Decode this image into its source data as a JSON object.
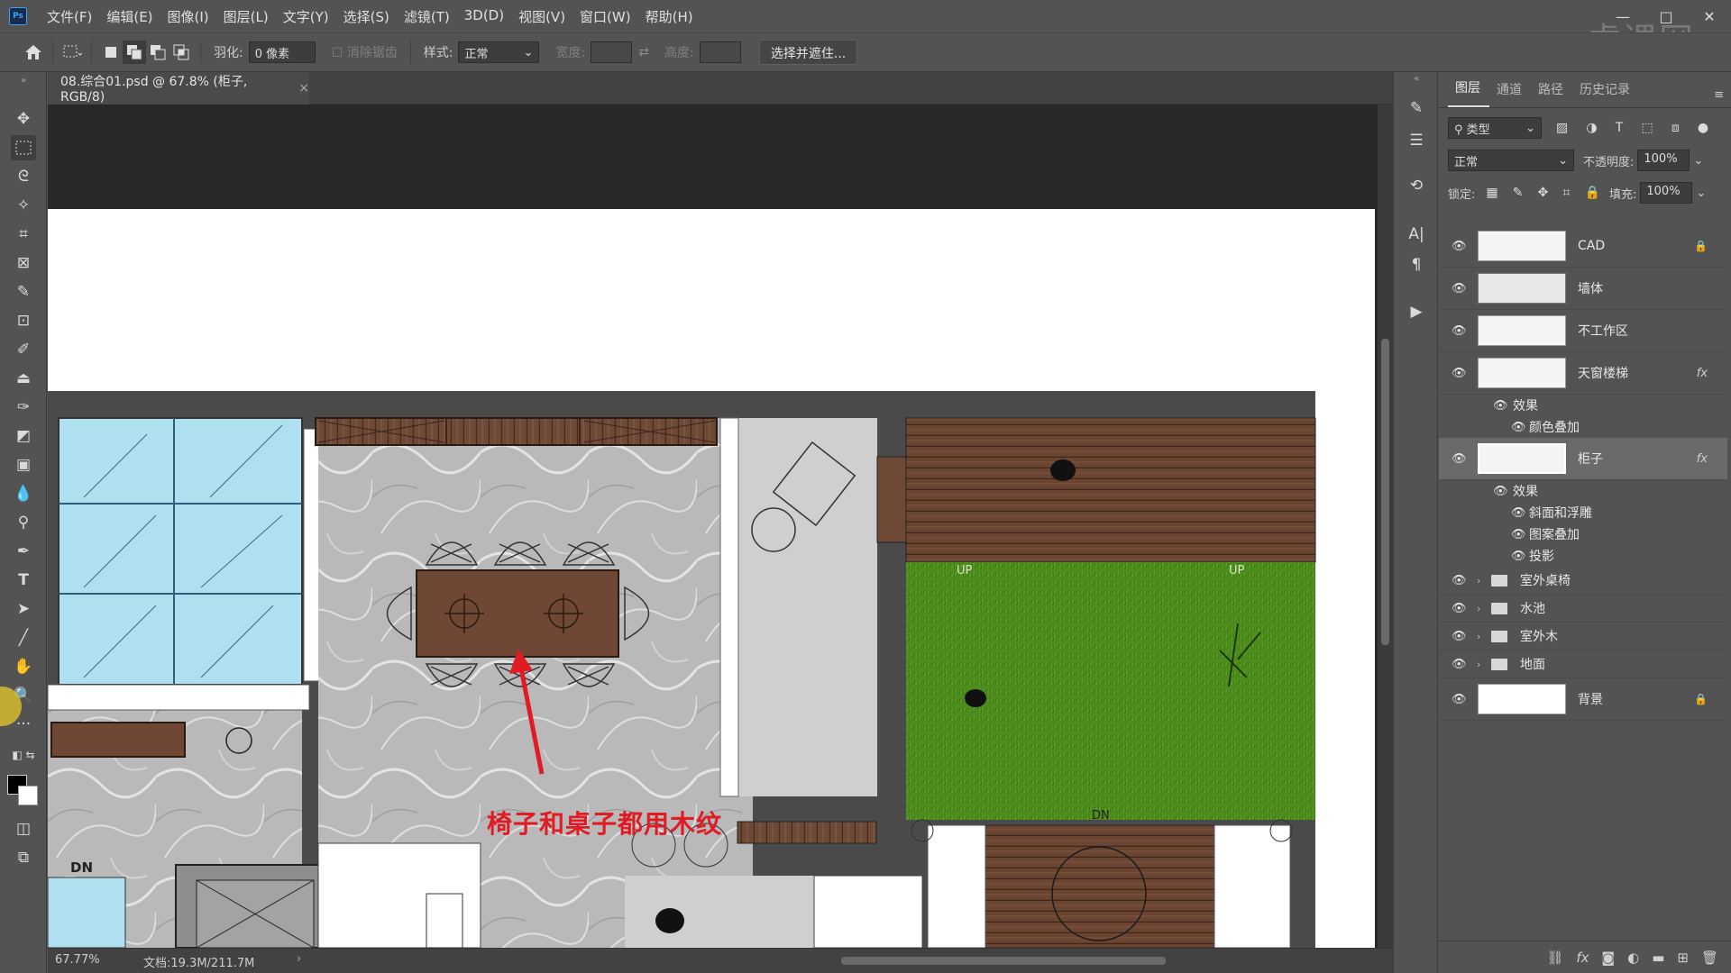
{
  "app": {
    "logo": "Ps",
    "watermark": "虎课网"
  },
  "menu": [
    "文件(F)",
    "编辑(E)",
    "图像(I)",
    "图层(L)",
    "文字(Y)",
    "选择(S)",
    "滤镜(T)",
    "3D(D)",
    "视图(V)",
    "窗口(W)",
    "帮助(H)"
  ],
  "window_controls": {
    "minimize": "—",
    "maximize": "□",
    "close": "✕"
  },
  "options": {
    "feather_label": "羽化:",
    "feather_value": "0 像素",
    "antialias_label": "消除锯齿",
    "style_label": "样式:",
    "style_value": "正常",
    "width_label": "宽度:",
    "height_label": "高度:",
    "select_mask_button": "选择并遮住..."
  },
  "document": {
    "tab_title": "08.综合01.psd @ 67.8% (柜子, RGB/8)",
    "close_glyph": "×",
    "zoom": "67.77%",
    "doc_size": "文档:19.3M/211.7M",
    "annotation": "椅子和桌子都用木纹"
  },
  "plan_labels": {
    "dn1": "DN",
    "dn2": "DN",
    "up1": "UP",
    "up2": "UP"
  },
  "panel": {
    "tabs": [
      "图层",
      "通道",
      "路径",
      "历史记录"
    ],
    "filter_label": "类型",
    "blend_mode": "正常",
    "opacity_label": "不透明度:",
    "opacity_value": "100%",
    "lock_label": "锁定:",
    "fill_label": "填充:",
    "fill_value": "100%"
  },
  "layers": [
    {
      "name": "CAD",
      "kind": "layer",
      "locked": true
    },
    {
      "name": "墙体",
      "kind": "layer"
    },
    {
      "name": "不工作区",
      "kind": "layer"
    },
    {
      "name": "天窗楼梯",
      "kind": "layer",
      "fx": "fx"
    },
    {
      "name": "效果",
      "kind": "effects"
    },
    {
      "name": "颜色叠加",
      "kind": "effect"
    },
    {
      "name": "柜子",
      "kind": "layer",
      "fx": "fx",
      "selected": true
    },
    {
      "name": "效果",
      "kind": "effects"
    },
    {
      "name": "斜面和浮雕",
      "kind": "effect"
    },
    {
      "name": "图案叠加",
      "kind": "effect"
    },
    {
      "name": "投影",
      "kind": "effect"
    },
    {
      "name": "室外桌椅",
      "kind": "group"
    },
    {
      "name": "水池",
      "kind": "group"
    },
    {
      "name": "室外木",
      "kind": "group"
    },
    {
      "name": "地面",
      "kind": "group"
    },
    {
      "name": "背景",
      "kind": "layer",
      "locked": true
    }
  ],
  "colors": {
    "ui_bg": "#535353",
    "canvas_bg": "#282828",
    "annotation": "#e01b24",
    "grass": "#4c8c1e",
    "wood": "#6e4a34",
    "glass": "#aee0f0"
  }
}
